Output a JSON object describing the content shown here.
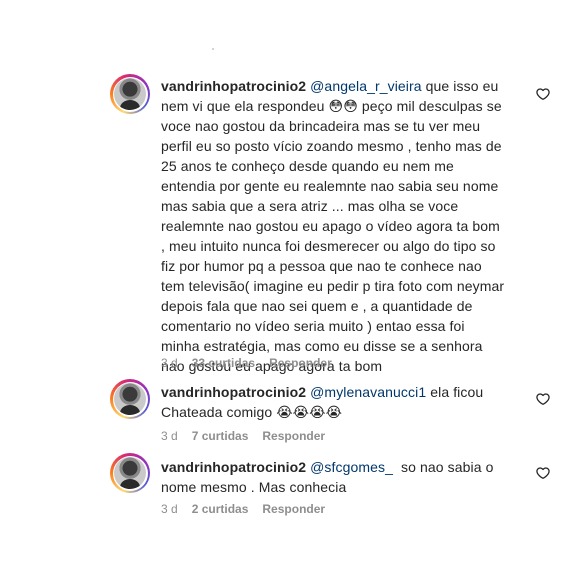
{
  "comments": [
    {
      "username": "vandrinhopatrocinio2",
      "mention": "@angela_r_vieira",
      "text": " que isso eu nem vi que ela respondeu 😳😳 peço mil desculpas se voce nao gostou da brincadeira mas se tu ver meu perfil eu so posto vício zoando mesmo , tenho mas de 25 anos te conheço desde quando eu nem me entendia por gente eu realemnte nao sabia seu nome mas sabia que a sera atriz ... mas olha se voce realemnte nao gostou eu apago o vídeo agora ta bom , meu intuito nunca foi desmerecer ou algo do tipo so fiz por humor pq a pessoa que nao te conhece nao tem televisão( imagine eu pedir p tira foto com neymar depois fala que nao sei quem e , a quantidade de comentario no vídeo seria muito ) entao essa foi minha estratégia, mas como eu disse se a senhora nao gostou eu apago agora ta bom",
      "time": "3 d",
      "likes": "33 curtidas",
      "reply": "Responder"
    },
    {
      "username": "vandrinhopatrocinio2",
      "mention": "@mylenavanucci1",
      "text": " ela ficou Chateada comigo 😭😭😭😭",
      "time": "3 d",
      "likes": "7 curtidas",
      "reply": "Responder"
    },
    {
      "username": "vandrinhopatrocinio2",
      "mention": "@sfcgomes_",
      "text": "  so nao sabia o nome mesmo . Mas conhecia",
      "time": "3 d",
      "likes": "2 curtidas",
      "reply": "Responder"
    }
  ],
  "icons": {
    "like": "heart-outline-icon"
  }
}
